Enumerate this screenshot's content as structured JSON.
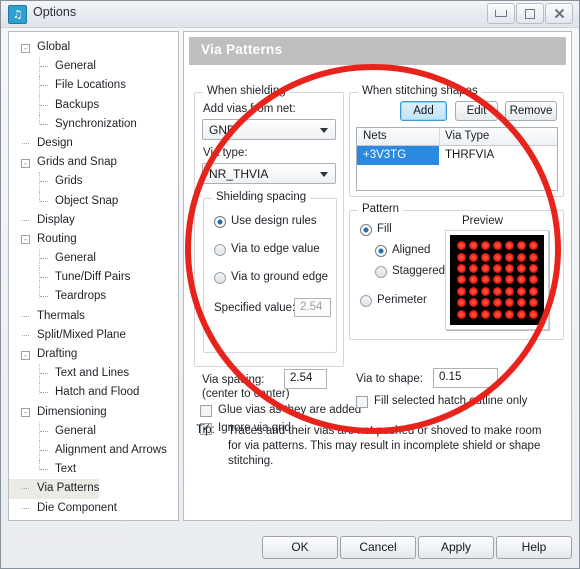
{
  "window": {
    "title": "Options",
    "icon": "music-note-icon",
    "buttons": {
      "minimize": "minimize-icon",
      "maximize": "maximize-icon",
      "close": "✖"
    }
  },
  "sidebar": {
    "items": [
      {
        "label": "Global",
        "level": 0,
        "expander": "-",
        "selected": false
      },
      {
        "label": "General",
        "level": 1,
        "expander": "",
        "selected": false
      },
      {
        "label": "File Locations",
        "level": 1,
        "expander": "",
        "selected": false
      },
      {
        "label": "Backups",
        "level": 1,
        "expander": "",
        "selected": false
      },
      {
        "label": "Synchronization",
        "level": 1,
        "expander": "",
        "selected": false
      },
      {
        "label": "Design",
        "level": 0,
        "expander": "",
        "selected": false
      },
      {
        "label": "Grids and Snap",
        "level": 0,
        "expander": "-",
        "selected": false
      },
      {
        "label": "Grids",
        "level": 1,
        "expander": "",
        "selected": false
      },
      {
        "label": "Object Snap",
        "level": 1,
        "expander": "",
        "selected": false
      },
      {
        "label": "Display",
        "level": 0,
        "expander": "",
        "selected": false
      },
      {
        "label": "Routing",
        "level": 0,
        "expander": "-",
        "selected": false
      },
      {
        "label": "General",
        "level": 1,
        "expander": "",
        "selected": false
      },
      {
        "label": "Tune/Diff Pairs",
        "level": 1,
        "expander": "",
        "selected": false
      },
      {
        "label": "Teardrops",
        "level": 1,
        "expander": "",
        "selected": false
      },
      {
        "label": "Thermals",
        "level": 0,
        "expander": "",
        "selected": false
      },
      {
        "label": "Split/Mixed Plane",
        "level": 0,
        "expander": "",
        "selected": false
      },
      {
        "label": "Drafting",
        "level": 0,
        "expander": "-",
        "selected": false
      },
      {
        "label": "Text and Lines",
        "level": 1,
        "expander": "",
        "selected": false
      },
      {
        "label": "Hatch and Flood",
        "level": 1,
        "expander": "",
        "selected": false
      },
      {
        "label": "Dimensioning",
        "level": 0,
        "expander": "-",
        "selected": false
      },
      {
        "label": "General",
        "level": 1,
        "expander": "",
        "selected": false
      },
      {
        "label": "Alignment and Arrows",
        "level": 1,
        "expander": "",
        "selected": false
      },
      {
        "label": "Text",
        "level": 1,
        "expander": "",
        "selected": false
      },
      {
        "label": "Via Patterns",
        "level": 0,
        "expander": "",
        "selected": true
      },
      {
        "label": "Die Component",
        "level": 0,
        "expander": "",
        "selected": false
      }
    ]
  },
  "page": {
    "header": "Via Patterns",
    "shielding": {
      "legend": "When shielding",
      "net_label": "Add vias from net:",
      "net_value": "GND",
      "via_type_label": "Via type:",
      "via_type_value": "NR_THVIA",
      "spacing_group": {
        "legend": "Shielding spacing",
        "options": [
          {
            "label": "Use design rules",
            "selected": true
          },
          {
            "label": "Via to edge value",
            "selected": false
          },
          {
            "label": "Via to ground edge",
            "selected": false
          }
        ],
        "specified_label": "Specified value:",
        "specified_value": "2.54"
      },
      "via_spacing_label": "Via spacing:",
      "via_spacing_sub": "(center to center)",
      "via_spacing_value": "2.54",
      "glue_label": "Glue vias as they are added",
      "glue_checked": false,
      "ignore_label": "Ignore via grid",
      "ignore_checked": true
    },
    "stitching": {
      "legend": "When stitching shapes",
      "buttons": {
        "add": "Add",
        "edit": "Edit",
        "remove": "Remove"
      },
      "columns": [
        "Nets",
        "Via Type"
      ],
      "rows": [
        {
          "net": "+3V3TG",
          "via_type": "THRFVIA",
          "selected": true
        }
      ]
    },
    "pattern": {
      "legend": "Pattern",
      "fill_label": "Fill",
      "fill_selected": true,
      "aligned_label": "Aligned",
      "aligned_selected": true,
      "staggered_label": "Staggered",
      "staggered_selected": false,
      "perimeter_label": "Perimeter",
      "perimeter_selected": false,
      "preview_legend": "Preview",
      "preview_grid_cols": 7,
      "preview_grid_rows": 7,
      "preview_via_color": "#e01b10",
      "preview_bg_color": "#000000"
    },
    "via_to_shape_label": "Via to shape:",
    "via_to_shape_value": "0.15",
    "fill_hatch_label": "Fill selected hatch outline only",
    "fill_hatch_checked": false,
    "tip_label": "Tip:",
    "tip_text": "Traces and their vias are not pushed or shoved to make room for via patterns. This may result in incomplete shield or shape stitching."
  },
  "footer": {
    "ok": "OK",
    "cancel": "Cancel",
    "apply": "Apply",
    "help": "Help"
  },
  "annotation": {
    "shape": "red-ellipse-highlight",
    "color": "#e8231c"
  }
}
